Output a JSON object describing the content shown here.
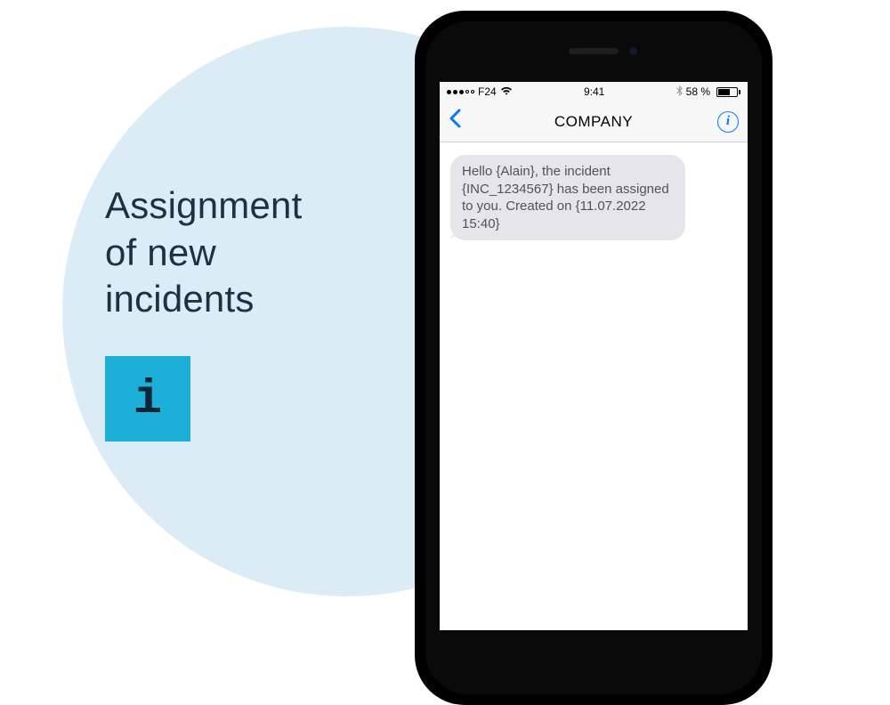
{
  "heading": "Assignment\nof new\nincidents",
  "info_glyph": "i",
  "status_bar": {
    "carrier": "F24",
    "time": "9:41",
    "battery_pct": "58 %"
  },
  "nav": {
    "title": "COMPANY"
  },
  "message": {
    "text": "Hello {Alain}, the incident {INC_1234567} has been assigned  to you. Created on {11.07.2022 15:40}"
  }
}
